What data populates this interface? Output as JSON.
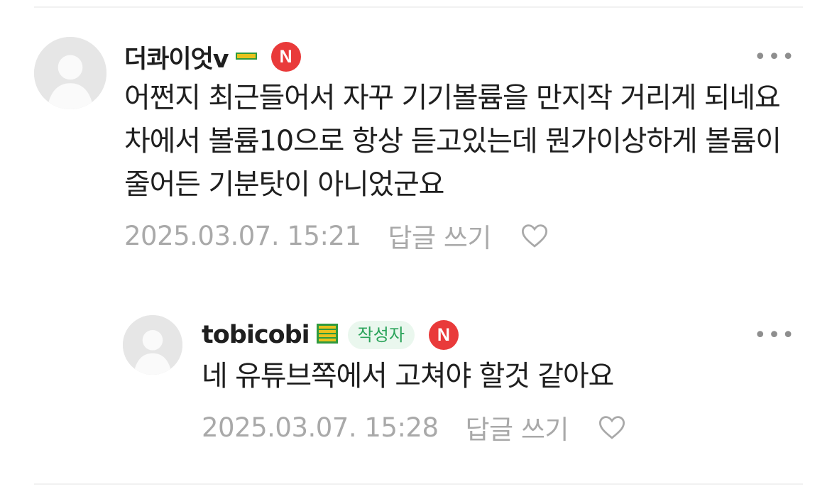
{
  "comments": [
    {
      "nickname": "더콰이엇v",
      "text": "어쩐지 최근들어서 자꾸 기기볼륨을 만지작 거리게 되네요 차에서 볼륨10으로 항상 듣고있는데 뭔가이상하게 볼륨이 줄어든 기분탓이 아니었군요",
      "timestamp": "2025.03.07. 15:21",
      "reply_label": "답글 쓰기",
      "n_badge": "N",
      "more": "•••",
      "level_icon": "level-bar-icon",
      "level_color": "#d8b31c"
    },
    {
      "nickname": "tobicobi",
      "author_badge": "작성자",
      "text": "네 유튜브쪽에서 고쳐야 할것 같아요",
      "timestamp": "2025.03.07. 15:28",
      "reply_label": "답글 쓰기",
      "n_badge": "N",
      "more": "•••",
      "level_icon": "level-stack-icon",
      "level_color": "#d8b31c"
    }
  ]
}
